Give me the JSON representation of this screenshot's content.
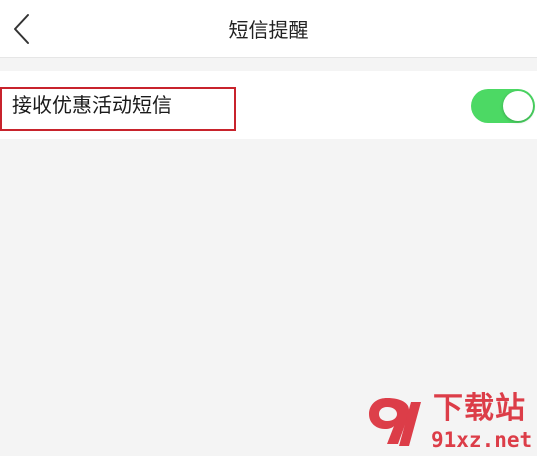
{
  "header": {
    "title": "短信提醒",
    "back_icon": "chevron-left-icon"
  },
  "settings": {
    "promo_sms": {
      "label": "接收优惠活动短信",
      "enabled": true
    }
  },
  "watermark": {
    "title": "下载站",
    "url": "91xz.net"
  },
  "colors": {
    "toggle_on": "#4cd964",
    "highlight": "#c8232c",
    "watermark": "#d81e2b",
    "background": "#f4f4f4"
  }
}
